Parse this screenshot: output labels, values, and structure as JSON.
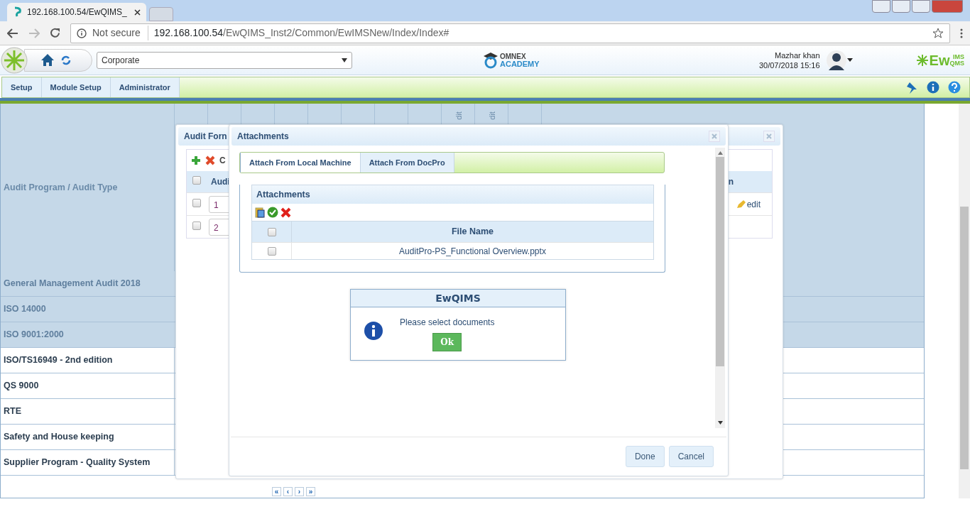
{
  "browser": {
    "tab_title": "192.168.100.54/EwQIMS_",
    "security": "Not secure",
    "host": "192.168.100.54",
    "path": "/EwQIMS_Inst2/Common/EwIMSNew/Index/Index#"
  },
  "header": {
    "location_select": "Corporate",
    "academy_logo": [
      "OMNEX",
      "ACADEMY"
    ],
    "user_name": "Mazhar khan",
    "datetime": "30/07/2018 15:16",
    "product_logo": {
      "main": "Ew",
      "sup": "IMS",
      "sub": "QMS"
    }
  },
  "menu": [
    {
      "label": "Setup"
    },
    {
      "label": "Module Setup"
    },
    {
      "label": "Administrator"
    }
  ],
  "grid": {
    "header": "Audit Program / Audit Type",
    "column_headers": [
      "dit",
      "dit"
    ],
    "rows": [
      {
        "label": "General Management Audit 2018",
        "shaded": true
      },
      {
        "label": "ISO 14000",
        "shaded": true
      },
      {
        "label": "ISO 9001:2000",
        "shaded": true
      },
      {
        "label": "ISO/TS16949 - 2nd edition",
        "shaded": false
      },
      {
        "label": "QS 9000",
        "shaded": false
      },
      {
        "label": "RTE",
        "shaded": false
      },
      {
        "label": "Safety and House keeping",
        "shaded": false
      },
      {
        "label": "Supplier Program - Quality System",
        "shaded": false
      }
    ]
  },
  "pager": [
    "«",
    "‹",
    "›",
    "»"
  ],
  "audit_form": {
    "title": "Audit Forn",
    "toolbar_text": "C",
    "columns": [
      "Audi",
      "n"
    ],
    "header_checked": false,
    "rows": [
      {
        "number": "1",
        "checked": false,
        "edit_link": "edit"
      },
      {
        "number": "2",
        "checked": false
      }
    ]
  },
  "attachments": {
    "title": "Attachments",
    "tabs": [
      {
        "label": "Attach From Local Machine",
        "selected": true
      },
      {
        "label": "Attach From DocPro",
        "selected": false
      }
    ],
    "grid_title": "Attachments",
    "header_checked": false,
    "column": "File Name",
    "files": [
      {
        "name": "AuditPro-PS_Functional Overview.pptx",
        "checked": false
      }
    ],
    "buttons": [
      "Done",
      "Cancel"
    ]
  },
  "message": {
    "title": "EwQIMS",
    "text": "Please select documents",
    "button": "Ok"
  }
}
